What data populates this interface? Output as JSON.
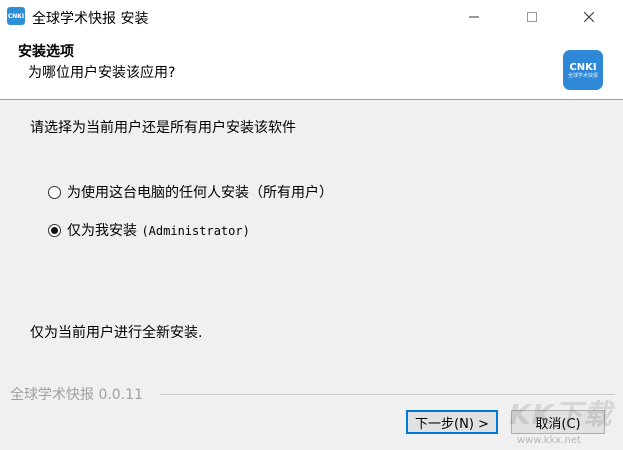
{
  "window": {
    "icon_text": "CNKI",
    "title": "全球学术快报 安装",
    "controls": {
      "minimize": "—",
      "maximize": "☐",
      "close": "✕"
    }
  },
  "header": {
    "title": "安装选项",
    "subtitle": "为哪位用户安装该应用?",
    "logo_text": "CNKI",
    "logo_subtext": "全球学术快报"
  },
  "body": {
    "prompt": "请选择为当前用户还是所有用户安装该软件",
    "options": [
      {
        "label_cn": "为使用这台电脑的任何人安装（所有用户）",
        "label_mono": "",
        "selected": false
      },
      {
        "label_cn": "仅为我安装",
        "label_mono": "(Administrator)",
        "selected": true
      }
    ],
    "description": "仅为当前用户进行全新安装."
  },
  "footer": {
    "version_label": "全球学术快报 0.0.11",
    "next_button": "下一步(N) >",
    "cancel_button": "取消(C)"
  },
  "watermark": {
    "main": "KK下载",
    "url": "www.kkx.net"
  },
  "colors": {
    "accent": "#2e88d6",
    "focus_border": "#0078d7",
    "background": "#f0f0f0"
  }
}
